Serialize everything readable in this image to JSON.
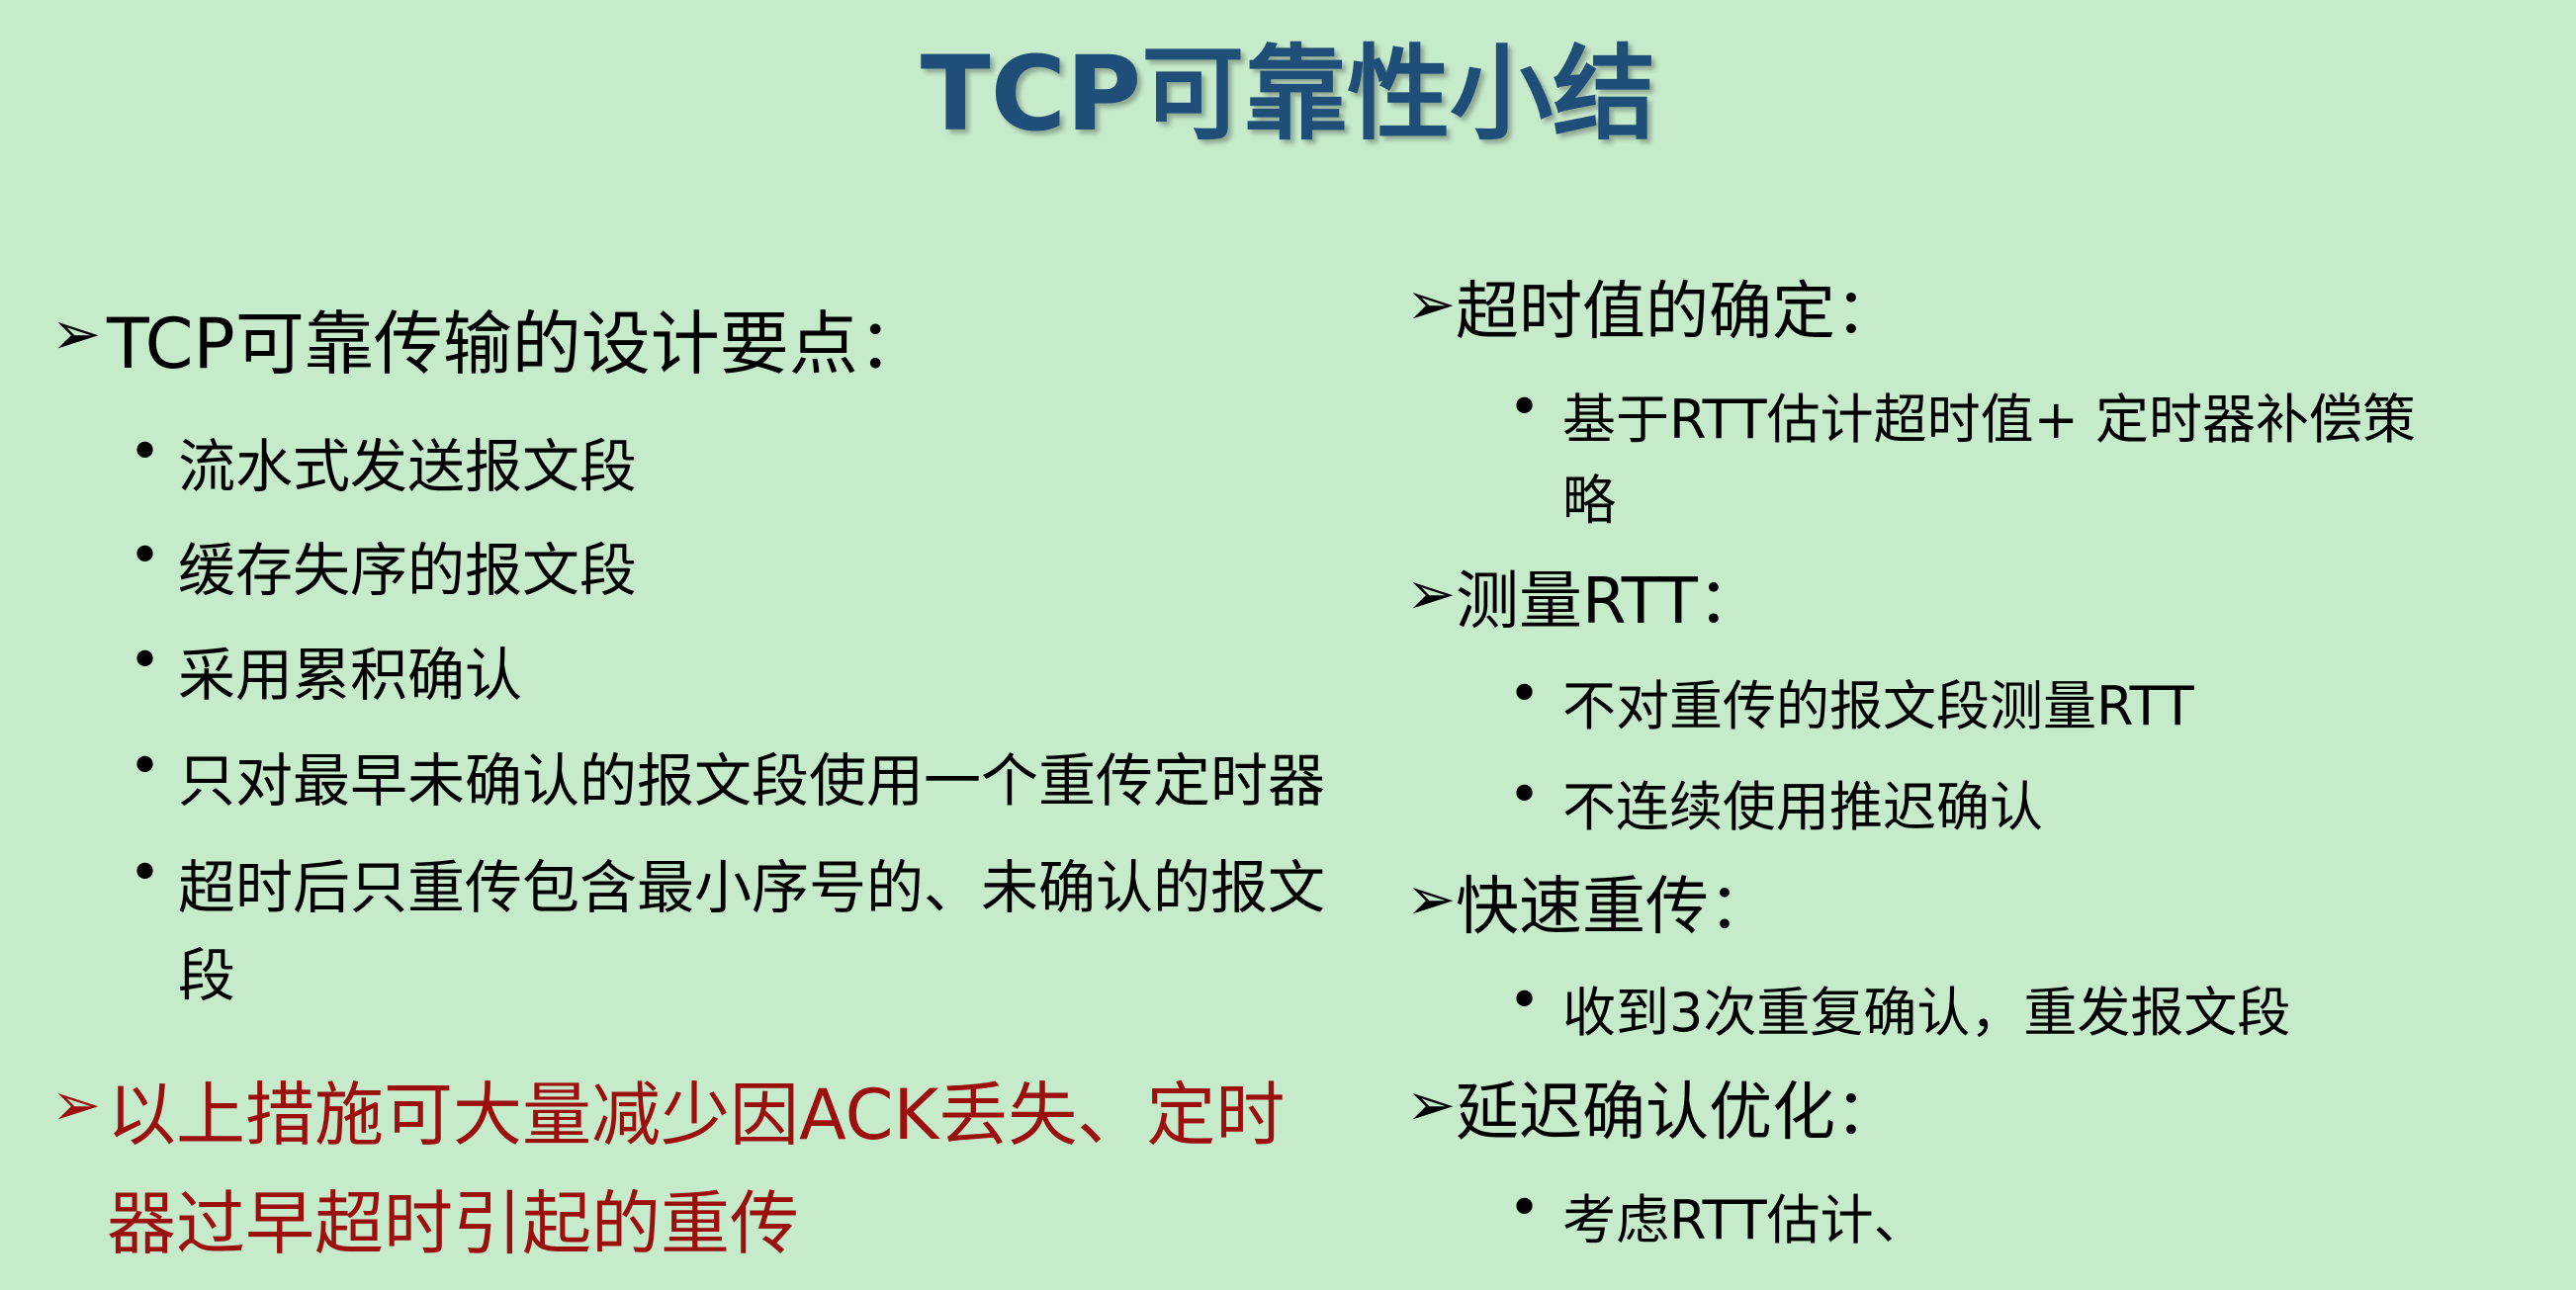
{
  "slide": {
    "title": "TCP可靠性小结",
    "colors": {
      "background": "#c6ebcb",
      "title": "#1f4e79",
      "emphasis": "#9c0f0f",
      "text": "#000000"
    },
    "left_column": {
      "heading": "TCP可靠传输的设计要点：",
      "points": [
        "流水式发送报文段",
        "缓存失序的报文段",
        "采用累积确认",
        "只对最早未确认的报文段使用一个重传定时器",
        "超时后只重传包含最小序号的、未确认的报文",
        "段"
      ],
      "conclusion_line1": "以上措施可大量减少因ACK丢失、定时",
      "conclusion_line2": "器过早超时引起的重传"
    },
    "right_column": {
      "sections": [
        {
          "heading": "超时值的确定：",
          "points": [
            "基于RTT估计超时值+ 定时器补偿策",
            "略"
          ]
        },
        {
          "heading": "测量RTT：",
          "points": [
            "不对重传的报文段测量RTT",
            "不连续使用推迟确认"
          ]
        },
        {
          "heading": "快速重传：",
          "points": [
            "收到3次重复确认，重发报文段"
          ]
        },
        {
          "heading": "延迟确认优化：",
          "points": [
            "考虑RTT估计、"
          ]
        }
      ]
    },
    "icons": {
      "level1_bullet": "arrowhead-bullet-icon",
      "level2_bullet": "dot-bullet-icon"
    }
  }
}
